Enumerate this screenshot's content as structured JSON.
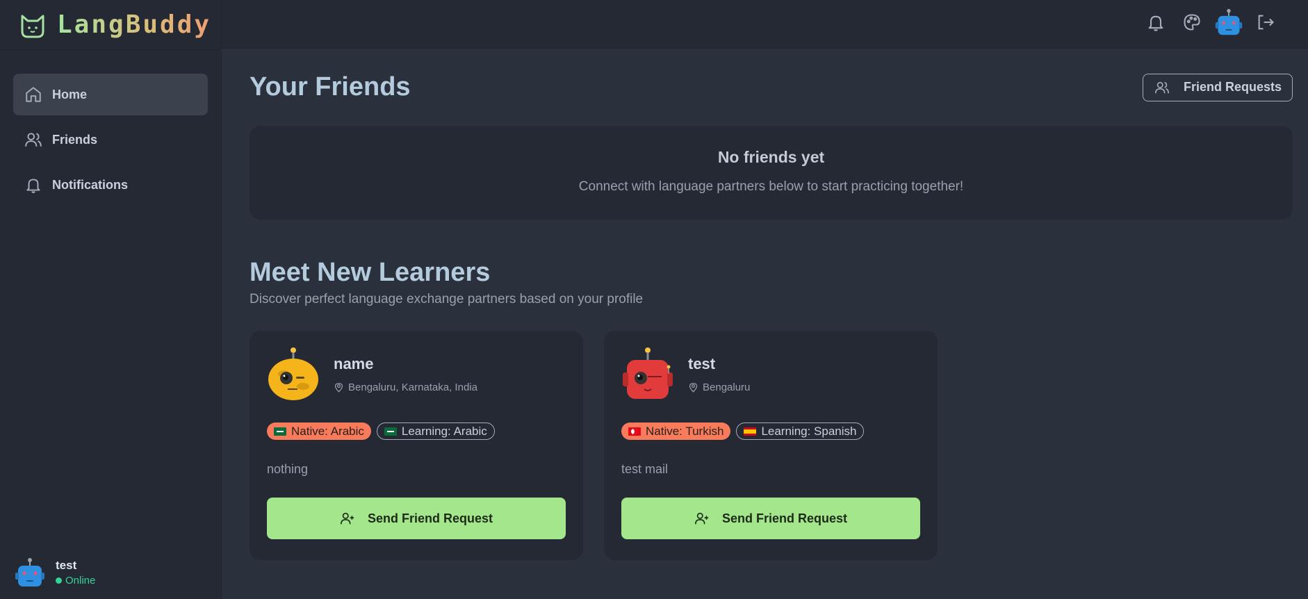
{
  "brand": {
    "name": "LangBuddy",
    "icon": "cat-face-icon"
  },
  "sidebar": {
    "items": [
      {
        "label": "Home",
        "icon": "home-icon",
        "active": true
      },
      {
        "label": "Friends",
        "icon": "users-icon",
        "active": false
      },
      {
        "label": "Notifications",
        "icon": "bell-icon",
        "active": false
      }
    ],
    "user": {
      "name": "test",
      "status": "Online",
      "avatar": "robot-avatar"
    }
  },
  "header": {
    "icons": [
      "bell-icon",
      "palette-icon",
      "robot-avatar",
      "logout-icon"
    ]
  },
  "friends_section": {
    "title": "Your Friends",
    "requests_button": "Friend Requests",
    "empty_title": "No friends yet",
    "empty_subtitle": "Connect with language partners below to start practicing together!"
  },
  "learners_section": {
    "title": "Meet New Learners",
    "subtitle": "Discover perfect language exchange partners based on your profile",
    "cards": [
      {
        "name": "name",
        "location": "Bengaluru, Karnataka, India",
        "native": "Native: Arabic",
        "learning": "Learning: Arabic",
        "bio": "nothing",
        "button": "Send Friend Request"
      },
      {
        "name": "test",
        "location": "Bengaluru",
        "native": "Native: Turkish",
        "learning": "Learning: Spanish",
        "bio": "test mail",
        "button": "Send Friend Request"
      }
    ]
  },
  "colors": {
    "background": "#2a303c",
    "panel": "#242933",
    "accent_green": "#a3e68c",
    "accent_orange": "#f87c5b",
    "online": "#36d399"
  }
}
